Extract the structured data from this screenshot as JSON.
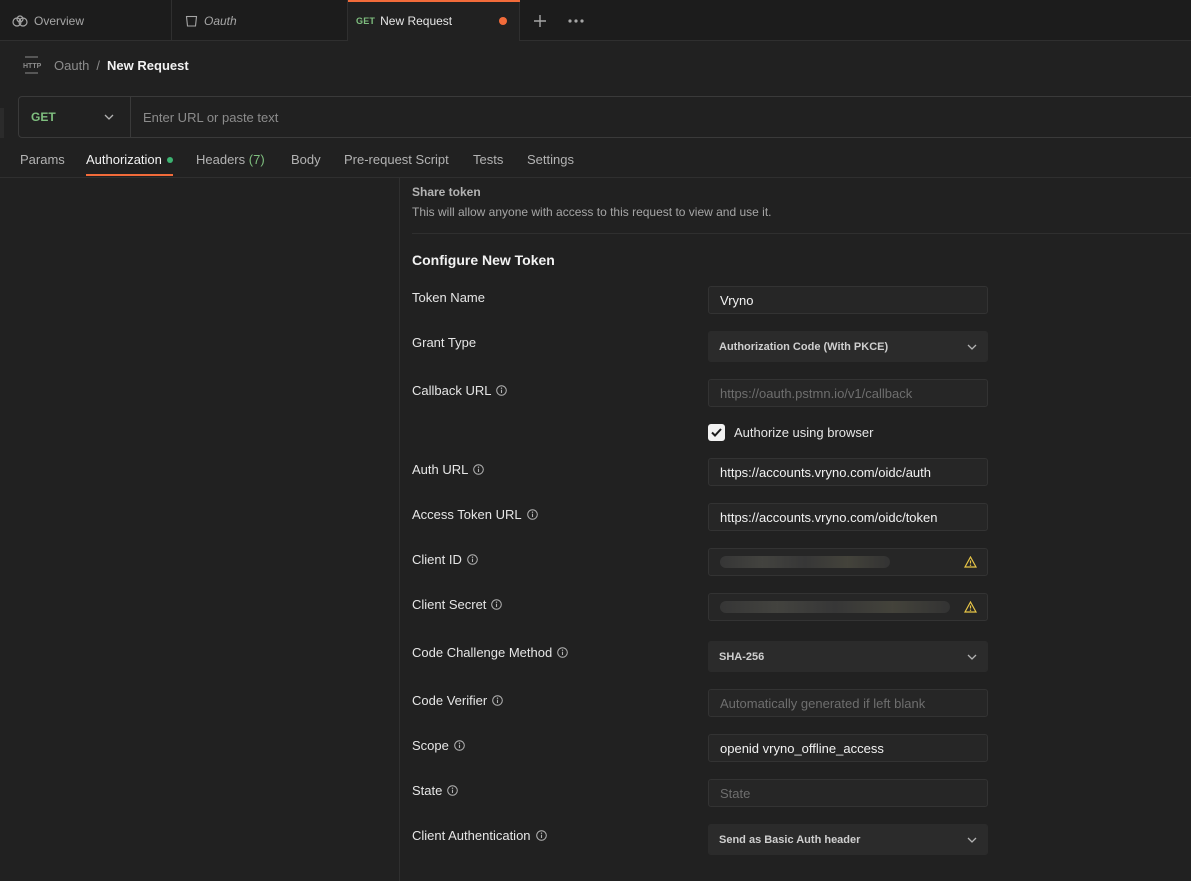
{
  "tabs": [
    {
      "label": "Overview",
      "icon": "overview-icon"
    },
    {
      "label": "Oauth",
      "icon": "collection-icon"
    },
    {
      "method": "GET",
      "label": "New Request",
      "unsaved": true
    }
  ],
  "breadcrumb": {
    "icon": "http-icon",
    "parent": "Oauth",
    "separator": "/",
    "current": "New Request"
  },
  "request": {
    "method": "GET",
    "url_value": "",
    "url_placeholder": "Enter URL or paste text"
  },
  "request_tabs": [
    {
      "label": "Params"
    },
    {
      "label": "Authorization",
      "active": true
    },
    {
      "label": "Headers",
      "count": "(7)"
    },
    {
      "label": "Body"
    },
    {
      "label": "Pre-request Script"
    },
    {
      "label": "Tests"
    },
    {
      "label": "Settings"
    }
  ],
  "share": {
    "title": "Share token",
    "description": "This will allow anyone with access to this request to view and use it."
  },
  "config": {
    "title": "Configure New Token",
    "token_name": {
      "label": "Token Name",
      "value": "Vryno"
    },
    "grant_type": {
      "label": "Grant Type",
      "value": "Authorization Code (With PKCE)"
    },
    "callback_url": {
      "label": "Callback URL",
      "placeholder": "https://oauth.pstmn.io/v1/callback"
    },
    "authorize_browser": {
      "label": "Authorize using browser",
      "checked": true
    },
    "auth_url": {
      "label": "Auth URL",
      "value": "https://accounts.vryno.com/oidc/auth"
    },
    "access_token_url": {
      "label": "Access Token URL",
      "value": "https://accounts.vryno.com/oidc/token"
    },
    "client_id": {
      "label": "Client ID"
    },
    "client_secret": {
      "label": "Client Secret"
    },
    "code_challenge": {
      "label": "Code Challenge Method",
      "value": "SHA-256"
    },
    "code_verifier": {
      "label": "Code Verifier",
      "placeholder": "Automatically generated if left blank"
    },
    "scope": {
      "label": "Scope",
      "value": "openid vryno_offline_access"
    },
    "state": {
      "label": "State",
      "placeholder": "State"
    },
    "client_auth": {
      "label": "Client Authentication",
      "value": "Send as Basic Auth header"
    }
  },
  "colors": {
    "accent": "#f26b3a",
    "method_get": "#7fbf7f",
    "status_dot": "#3cb371",
    "warning": "#e8c547"
  }
}
